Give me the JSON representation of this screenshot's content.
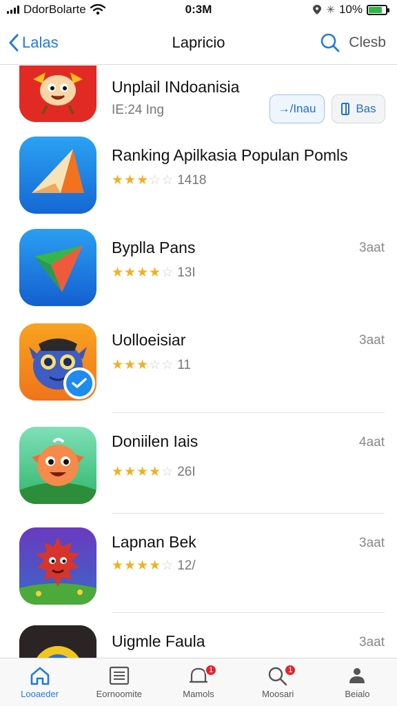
{
  "status_bar": {
    "carrier": "DdorBolarte",
    "time": "0:3M",
    "battery_text": "10%",
    "battery_level_percent": 80
  },
  "nav": {
    "back_label": "Lalas",
    "title": "Lapricio",
    "right_label": "Clesb"
  },
  "apps": [
    {
      "name": "Unplail INdoanisia",
      "meta_text": "IE:24 Ing",
      "stars": null,
      "count": "",
      "action": "",
      "buttons": [
        "→/Inau",
        "Bas"
      ]
    },
    {
      "name": "Ranking Apilkasia Populan Pomls",
      "stars": 3,
      "count": "1418",
      "action": ""
    },
    {
      "name": "Byplla Pans",
      "stars": 4,
      "count": "13I",
      "action": "3aat"
    },
    {
      "name": "Uolloeisiar",
      "stars": 3,
      "count": "11",
      "action": "3aat"
    },
    {
      "name": "Doniilen Iais",
      "stars": 4,
      "count": "26I",
      "action": "4aat"
    },
    {
      "name": "Lapnan Bek",
      "stars": 4,
      "count": "12/",
      "action": "3aat"
    },
    {
      "name": "Uigmle Faula",
      "stars": null,
      "count": "",
      "action": "3aat"
    }
  ],
  "tabs": [
    {
      "label": "Looaeder",
      "icon": "home-icon",
      "active": true,
      "badge": ""
    },
    {
      "label": "Eornoomite",
      "icon": "list-icon",
      "active": false,
      "badge": ""
    },
    {
      "label": "Mamols",
      "icon": "bell-icon",
      "active": false,
      "badge": "1"
    },
    {
      "label": "Moosari",
      "icon": "search-icon",
      "active": false,
      "badge": "1"
    },
    {
      "label": "Beialo",
      "icon": "person-icon",
      "active": false,
      "badge": ""
    }
  ],
  "colors": {
    "accent": "#1f7ae0",
    "star": "#f2b01e",
    "badge": "#e0242c"
  }
}
